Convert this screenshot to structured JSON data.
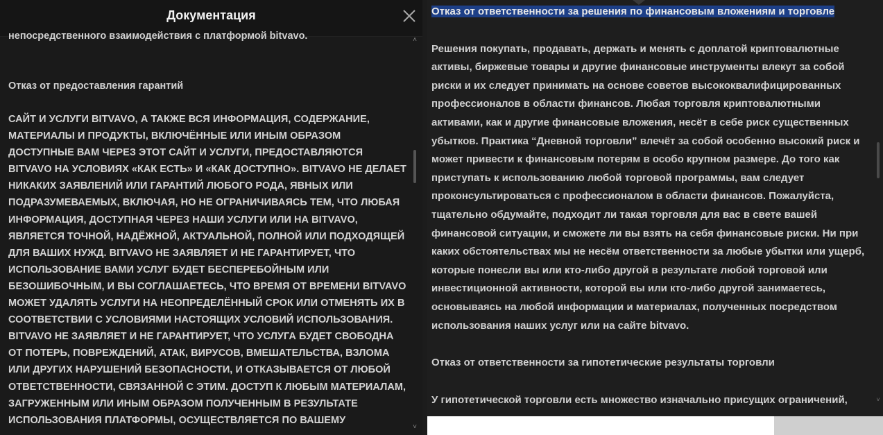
{
  "left_panel": {
    "title": "Документация",
    "cut_line": "непосредственного взаимодействия с платформой bitvavo.",
    "section_heading": "Отказ от предоставления гарантий",
    "body": "САЙТ И УСЛУГИ BITVAVO, А ТАКЖЕ ВСЯ ИНФОРМАЦИЯ, СОДЕРЖАНИЕ, МАТЕРИАЛЫ И ПРОДУКТЫ, ВКЛЮЧЁННЫЕ ИЛИ ИНЫМ ОБРАЗОМ ДОСТУПНЫЕ ВАМ ЧЕРЕЗ ЭТОТ САЙТ И УСЛУГИ, ПРЕДОСТАВЛЯЮТСЯ BITVAVO НА УСЛОВИЯХ «КАК ЕСТЬ» И «КАК ДОСТУПНО». BITVAVO НЕ ДЕЛАЕТ НИКАКИХ ЗАЯВЛЕНИЙ ИЛИ ГАРАНТИЙ ЛЮБОГО РОДА, ЯВНЫХ ИЛИ ПОДРАЗУМЕВАЕМЫХ, ВКЛЮЧАЯ, НО НЕ ОГРАНИЧИВАЯСЬ ТЕМ, ЧТО ЛЮБАЯ ИНФОРМАЦИЯ, ДОСТУПНАЯ ЧЕРЕЗ НАШИ УСЛУГИ ИЛИ НА BITVAVO, ЯВЛЯЕТСЯ ТОЧНОЙ, НАДЁЖНОЙ, АКТУАЛЬНОЙ, ПОЛНОЙ ИЛИ ПОДХОДЯЩЕЙ ДЛЯ ВАШИХ НУЖД. BITVAVO НЕ ЗАЯВЛЯЕТ И НЕ ГАРАНТИРУЕТ, ЧТО ИСПОЛЬЗОВАНИЕ ВАМИ УСЛУГ БУДЕТ БЕСПЕРЕБОЙНЫМ ИЛИ БЕЗОШИБОЧНЫМ, И ВЫ СОГЛАШАЕТЕСЬ, ЧТО ВРЕМЯ ОТ ВРЕМЕНИ BITVAVO МОЖЕТ УДАЛЯТЬ УСЛУГИ НА НЕОПРЕДЕЛЁННЫЙ СРОК ИЛИ ОТМЕНЯТЬ ИХ В СООТВЕТСТВИИ С УСЛОВИЯМИ НАСТОЯЩИХ УСЛОВИЙ ИСПОЛЬЗОВАНИЯ. BITVAVO НЕ ЗАЯВЛЯЕТ И НЕ ГАРАНТИРУЕТ, ЧТО УСЛУГА БУДЕТ СВОБОДНА ОТ ПОТЕРЬ, ПОВРЕЖДЕНИЙ, АТАК, ВИРУСОВ, ВМЕШАТЕЛЬСТВА, ВЗЛОМА ИЛИ ДРУГИХ НАРУШЕНИЙ БЕЗОПАСНОСТИ, И ОТКАЗЫВАЕТСЯ ОТ ЛЮБОЙ ОТВЕТСТВЕННОСТИ, СВЯЗАННОЙ С ЭТИМ. ДОСТУП К ЛЮБЫМ МАТЕРИАЛАМ, ЗАГРУЖЕННЫМ ИЛИ ИНЫМ ОБРАЗОМ ПОЛУЧЕННЫМ В РЕЗУЛЬТАТЕ ИСПОЛЬЗОВАНИЯ ПЛАТФОРМЫ, ОСУЩЕСТВЛЯЕТСЯ ПО ВАШЕМУ СОБСТВЕННОМУ УСМОТРЕНИЮ И НА ВАШ РИСК, И ВЫ НЕСЁТЕ ПОЛНУЮ",
    "icons": {
      "close": "close-icon",
      "scroll_up": "chevron-up-icon",
      "scroll_down": "chevron-down-icon"
    }
  },
  "right_panel": {
    "selected_heading": "Отказ от ответственности за решения по финансовым вложениям и торговле",
    "paragraph": "Решения покупать, продавать, держать и менять с доплатой криптовалютные активы, биржевые товары и другие финансовые инструменты влекут за собой риски и их следует принимать на основе советов высококвалифицированных профессионалов в области финансов. Любая торговля криптовалютными активами, как и другие финансовые вложения, несёт в себе риск существенных убытков. Практика “Дневной торговли” влечёт за собой особенно высокий риск и может привести к финансовым потерям в особо крупном размере. До того как приступать к использованию любой торговой программы, вам следует проконсультироваться с профессионалом в области финансов. Пожалуйста, тщательно обдумайте, подходит ли такая торговля для вас в свете вашей финансовой ситуации, и сможете ли вы взять на себя финансовые риски. Ни при каких обстоятельствах мы не несём ответственности за любые убытки или ущерб, которые понесли вы или кто-либо другой в результате любой торговой или инвестиционной активности, которой вы или кто-либо другой занимаетесь, основываясь на любой информации и материалах, полученных посредством использования наших услуг или на сайте bitvavo.",
    "heading2": "Отказ от ответственности за гипотетические результаты торговли",
    "paragraph2": "У гипотетической торговли есть множество изначально присущих ограничений,",
    "colors": {
      "selection": "#1d3f87",
      "background": "#1e1e1e",
      "text": "#cfcfcf"
    }
  }
}
